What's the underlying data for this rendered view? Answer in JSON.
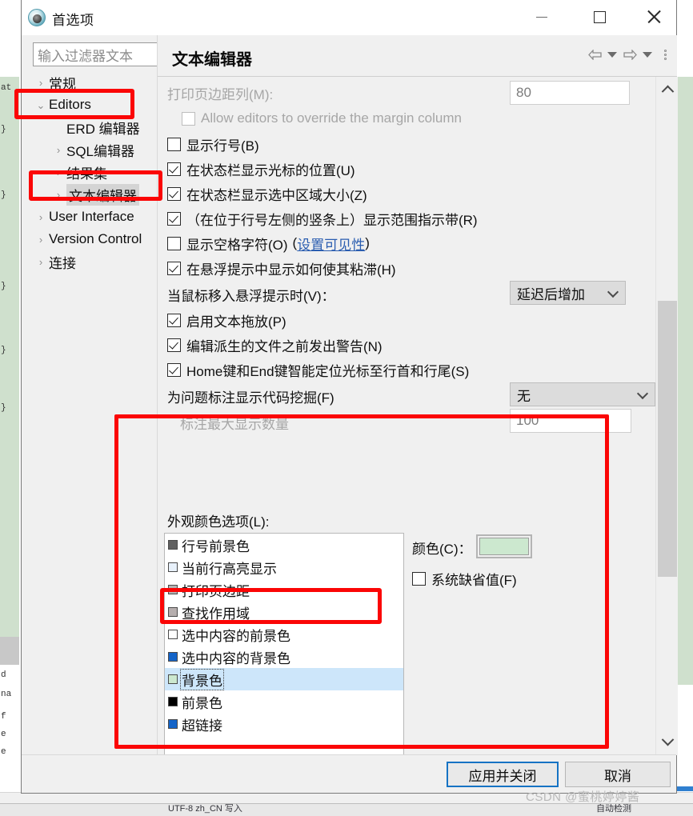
{
  "window": {
    "title": "首选项",
    "icon": "app-icon",
    "buttons": {
      "minimize": "minimize-icon",
      "maximize": "maximize-icon",
      "close": "close-icon"
    }
  },
  "sidebar": {
    "filter_placeholder": "输入过滤器文本",
    "filter_value": "",
    "items": [
      {
        "label": "常规",
        "indent": 1,
        "twisty": "›",
        "selected": false
      },
      {
        "label": "Editors",
        "indent": 1,
        "twisty": "⌄",
        "selected": false
      },
      {
        "label": "ERD 编辑器",
        "indent": 2,
        "twisty": "",
        "selected": false
      },
      {
        "label": "SQL编辑器",
        "indent": 2,
        "twisty": "›",
        "selected": false
      },
      {
        "label": "结果集",
        "indent": 2,
        "twisty": "›",
        "selected": false
      },
      {
        "label": "文本编辑器",
        "indent": 2,
        "twisty": "›",
        "selected": true
      },
      {
        "label": "User Interface",
        "indent": 1,
        "twisty": "›",
        "selected": false
      },
      {
        "label": "Version Control",
        "indent": 1,
        "twisty": "›",
        "selected": false
      },
      {
        "label": "连接",
        "indent": 1,
        "twisty": "›",
        "selected": false
      }
    ]
  },
  "page": {
    "title": "文本编辑器",
    "nav": {
      "back": "back-arrow-icon",
      "back_menu": "back-dropdown-icon",
      "forward": "forward-arrow-icon",
      "forward_menu": "forward-dropdown-icon",
      "menu": "view-menu-icon"
    }
  },
  "options": {
    "print_margin_label": "打印页边距列(M):",
    "print_margin_value": "80",
    "allow_override_label": "Allow editors to override the margin column",
    "allow_override_checked": false,
    "checkboxes": [
      {
        "label": "显示行号(B)",
        "checked": false
      },
      {
        "label": "在状态栏显示光标的位置(U)",
        "checked": true
      },
      {
        "label": "在状态栏显示选中区域大小(Z)",
        "checked": true
      },
      {
        "label": "（在位于行号左侧的竖条上）显示范围指示带(R)",
        "checked": true
      }
    ],
    "whitespace_label": "显示空格字符(O)",
    "whitespace_link_open": "(",
    "whitespace_link": "设置可见性",
    "whitespace_link_close": ")",
    "whitespace_checked": false,
    "sticky_hover_label": "在悬浮提示中显示如何使其粘滞(H)",
    "sticky_hover_checked": true,
    "mouse_hover_label": "当鼠标移入悬浮提示时(V)：",
    "mouse_hover_value": "延迟后增加",
    "post_checkboxes": [
      {
        "label": "启用文本拖放(P)",
        "checked": true
      },
      {
        "label": "编辑派生的文件之前发出警告(N)",
        "checked": true
      },
      {
        "label": "Home键和End键智能定位光标至行首和行尾(S)",
        "checked": true
      }
    ],
    "code_mining_label": "为问题标注显示代码挖掘(F)",
    "code_mining_value": "无",
    "max_annotations_label": "标注最大显示数量",
    "max_annotations_value": "100",
    "appearance_color_label": "外观颜色选项(L):",
    "color_items": [
      {
        "label": "行号前景色",
        "swatch": "#606060",
        "selected": false
      },
      {
        "label": "当前行高亮显示",
        "swatch": "#e8f1fb",
        "selected": false
      },
      {
        "label": "打印页边距",
        "swatch": "#b4b4b4",
        "selected": false
      },
      {
        "label": "查找作用域",
        "swatch": "#b6aeae",
        "selected": false
      },
      {
        "label": "选中内容的前景色",
        "swatch": "#ffffff",
        "selected": false
      },
      {
        "label": "选中内容的背景色",
        "swatch": "#1464c8",
        "selected": false
      },
      {
        "label": "背景色",
        "swatch": "#cce8cf",
        "selected": true
      },
      {
        "label": "前景色",
        "swatch": "#000000",
        "selected": false
      },
      {
        "label": "超链接",
        "swatch": "#1464c8",
        "selected": false
      }
    ],
    "color_picker_label": "颜色(C)：",
    "color_picker_value": "#cce8cf",
    "system_default_label": "系统缺省值(F)",
    "system_default_checked": false
  },
  "footer": {
    "apply_and_close": "应用并关闭",
    "cancel": "取消"
  },
  "watermark": "CSDN @蜜桃婷婷酱",
  "background": {
    "left_fragments": [
      "at",
      "}",
      "}",
      "}",
      "}",
      "}",
      "d",
      "na",
      "f",
      "e",
      "e"
    ],
    "status_text": "UTF-8    zh_CN    写入",
    "status_right": "自动检测"
  }
}
